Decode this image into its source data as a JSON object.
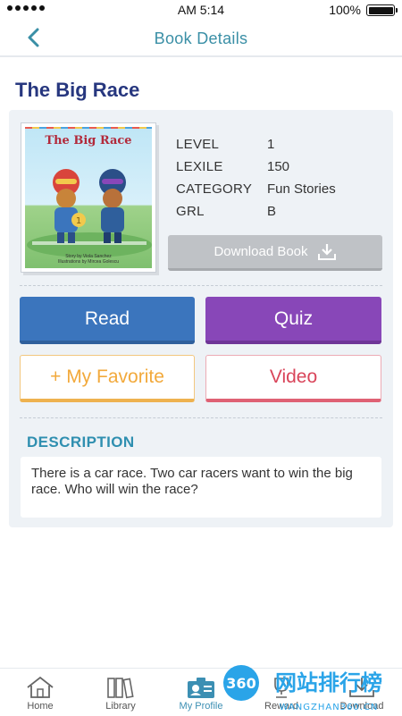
{
  "status_bar": {
    "time": "AM 5:14",
    "battery": "100%"
  },
  "header": {
    "title": "Book Details"
  },
  "book": {
    "title": "The Big Race",
    "cover_title": "The Big Race",
    "cover_credits_1": "Story by Viola Sanchez",
    "cover_credits_2": "Illustrations by Mircea Golescu",
    "meta": [
      {
        "key": "LEVEL",
        "value": "1"
      },
      {
        "key": "LEXILE",
        "value": "150"
      },
      {
        "key": "CATEGORY",
        "value": "Fun Stories"
      },
      {
        "key": "GRL",
        "value": "B"
      }
    ],
    "download_label": "Download Book"
  },
  "actions": {
    "read": "Read",
    "quiz": "Quiz",
    "favorite": "+ My Favorite",
    "video": "Video"
  },
  "description": {
    "heading": "DESCRIPTION",
    "text": "There is a car race. Two car racers want to win the big race. Who will win the race?"
  },
  "tabs": [
    {
      "label": "Home",
      "icon": "home-icon"
    },
    {
      "label": "Library",
      "icon": "library-icon"
    },
    {
      "label": "My Profile",
      "icon": "profile-icon"
    },
    {
      "label": "Reward",
      "icon": "reward-icon"
    },
    {
      "label": "Download",
      "icon": "download-icon"
    }
  ],
  "watermark": {
    "badge": "360",
    "text": "网站排行榜",
    "sub": "WANGZHAN360.CN"
  },
  "colors": {
    "accent": "#3a8fa6",
    "read": "#3b75bd",
    "quiz": "#8847b8",
    "favorite": "#f2a93b",
    "video": "#d9455a",
    "title": "#27377f"
  }
}
